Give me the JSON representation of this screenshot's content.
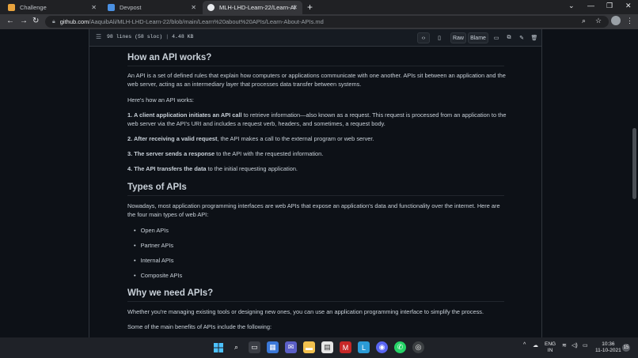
{
  "browser": {
    "tabs": [
      {
        "title": "Challenge",
        "fav_color": "#e8a33d"
      },
      {
        "title": "Devpost",
        "fav_color": "#4a90e2"
      },
      {
        "title": "MLH-LHD-Learn-22/Learn-About",
        "fav_color": "#e8eaed"
      }
    ],
    "new_tab": "+",
    "url_host": "github.com",
    "url_path": "/AaquibAli/MLH-LHD-Learn-22/blob/main/Learn%20about%20APIs/Learn-About-APIs.md"
  },
  "file_header": {
    "lines": "98 lines (58 sloc)",
    "size": "4.48 KB",
    "raw_label": "Raw",
    "blame_label": "Blame"
  },
  "doc": {
    "h_how": "How an API works?",
    "p_intro": "An API is a set of defined rules that explain how computers or applications communicate with one another. APIs sit between an application and the web server, acting as an intermediary layer that processes data transfer between systems.",
    "p_heres": "Here's how an API works:",
    "steps": [
      {
        "bold": "1. A client application initiates an API call",
        "rest": " to retrieve information—also known as a request. This request is processed from an application to the web server via the API's URI and includes a request verb, headers, and sometimes, a request body."
      },
      {
        "bold": "2. After receiving a valid request",
        "rest": ", the API makes a call to the external program or web server."
      },
      {
        "bold": "3. The server sends a response",
        "rest": " to the API with the requested information."
      },
      {
        "bold": "4. The API transfers the data",
        "rest": " to the initial requesting application."
      }
    ],
    "h_types": "Types of APIs",
    "p_types": "Nowadays, most application programming interfaces are web APIs that expose an application's data and functionality over the internet. Here are the four main types of web API:",
    "types": [
      "Open APIs",
      "Partner APIs",
      "Internal APIs",
      "Composite APIs"
    ],
    "h_why": "Why we need APIs?",
    "p_why": "Whether you're managing existing tools or designing new ones, you can use an application programming interface to simplify the process.",
    "p_benefits": "Some of the main benefits of APIs include the following:"
  },
  "taskbar": {
    "lang_top": "ENG",
    "lang_bottom": "IN",
    "time": "10:36",
    "date": "11-10-2021",
    "notifications": "15"
  }
}
